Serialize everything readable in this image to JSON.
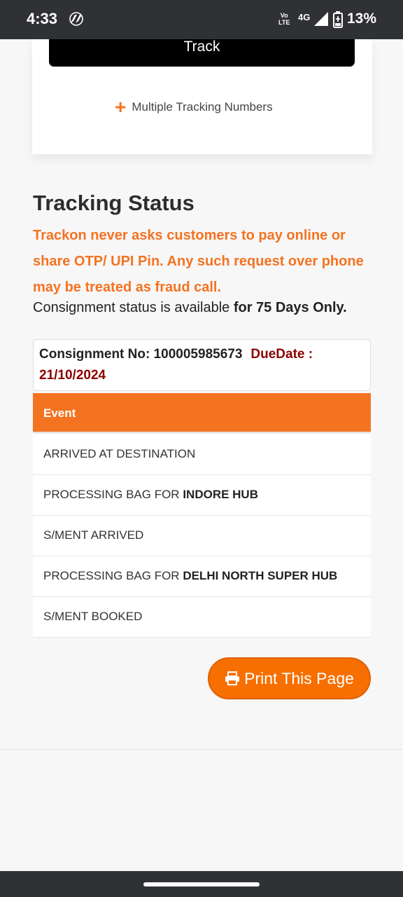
{
  "status_bar": {
    "time": "4:33",
    "volte_line1": "Vo",
    "volte_line2": "LTE",
    "network": "4G",
    "battery": "13%"
  },
  "top_card": {
    "track_label": "Track",
    "multiple_label": "Multiple Tracking Numbers",
    "plus_symbol": "+"
  },
  "tracking": {
    "title": "Tracking Status",
    "warning": "Trackon never asks customers to pay online or share OTP/ UPI Pin. Any such request over phone may be treated as fraud call.",
    "availability_prefix": "Consignment status is available ",
    "availability_bold": "for 75 Days Only.",
    "consignment_label": "Consignment No: 100005985673",
    "due_label": "DueDate :",
    "due_date": "21/10/2024",
    "event_header": "Event",
    "events": [
      {
        "text": "ARRIVED AT DESTINATION",
        "bold": ""
      },
      {
        "text": "PROCESSING BAG FOR ",
        "bold": "INDORE HUB"
      },
      {
        "text": "S/MENT ARRIVED",
        "bold": ""
      },
      {
        "text": "PROCESSING BAG FOR ",
        "bold": "DELHI NORTH SUPER HUB"
      },
      {
        "text": "S/MENT BOOKED",
        "bold": ""
      }
    ],
    "print_label": "Print This Page"
  },
  "colors": {
    "accent": "#f47321",
    "due_red": "#8b0000",
    "print_button": "#f76f00"
  }
}
